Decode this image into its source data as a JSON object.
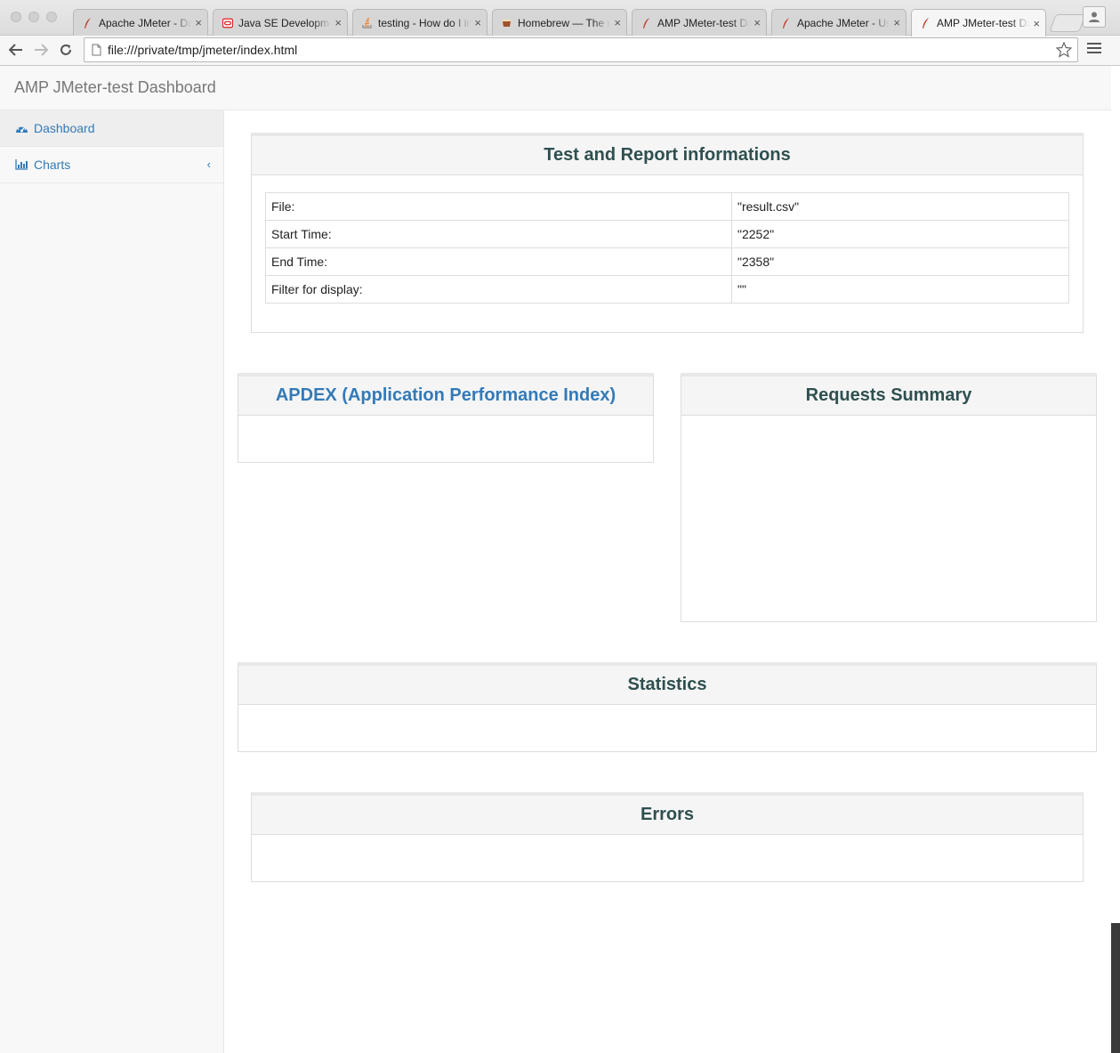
{
  "browser": {
    "tabs": [
      {
        "title": "Apache JMeter - Dashboard",
        "favicon": "feather-icon",
        "active": false
      },
      {
        "title": "Java SE Development Kit",
        "favicon": "oracle-icon",
        "active": false
      },
      {
        "title": "testing - How do I install",
        "favicon": "stackoverflow-icon",
        "active": false
      },
      {
        "title": "Homebrew — The missing",
        "favicon": "homebrew-icon",
        "active": false
      },
      {
        "title": "AMP JMeter-test Dashboard",
        "favicon": "feather-icon",
        "active": false
      },
      {
        "title": "Apache JMeter - User's Manual",
        "favicon": "feather-icon",
        "active": false
      },
      {
        "title": "AMP JMeter-test Dashboard",
        "favicon": "feather-icon",
        "active": true
      }
    ],
    "url": "file:///private/tmp/jmeter/index.html"
  },
  "app": {
    "brand": "AMP JMeter-test Dashboard"
  },
  "sidebar": {
    "items": [
      {
        "label": "Dashboard",
        "icon": "dashboard-icon",
        "active": true
      },
      {
        "label": "Charts",
        "icon": "bar-chart-icon",
        "active": false
      }
    ]
  },
  "panels": {
    "test_info": {
      "title": "Test and Report informations",
      "rows": [
        {
          "key": "File:",
          "value": "\"result.csv\""
        },
        {
          "key": "Start Time:",
          "value": "\"2252\""
        },
        {
          "key": "End Time:",
          "value": "\"2358\""
        },
        {
          "key": "Filter for display:",
          "value": "\"\""
        }
      ]
    },
    "apdex": {
      "title": "APDEX (Application Performance Index)"
    },
    "requests_summary": {
      "title": "Requests Summary"
    },
    "statistics": {
      "title": "Statistics"
    },
    "errors": {
      "title": "Errors"
    }
  },
  "colors": {
    "link": "#337ab7",
    "panel_title": "#2f4f4f",
    "header_bg": "#f8f8f8"
  }
}
